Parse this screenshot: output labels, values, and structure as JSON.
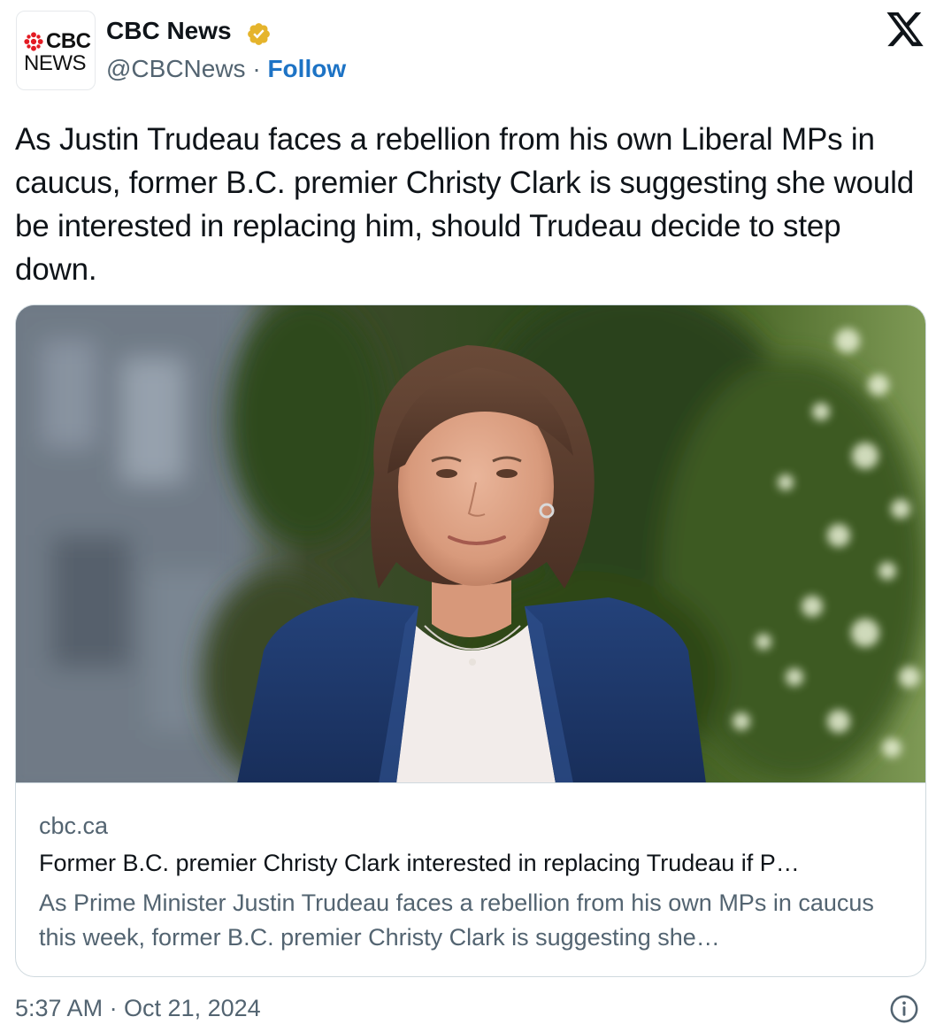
{
  "author": {
    "avatar_line1": "CBC",
    "avatar_line2": "NEWS",
    "name": "CBC News",
    "verified_icon": "verified-badge-icon",
    "verified_color": "#e5b42c",
    "handle": "@CBCNews",
    "separator": " · ",
    "follow_label": "Follow",
    "follow_color": "#1d73c5"
  },
  "platform": {
    "logo_icon": "x-logo-icon"
  },
  "tweet": {
    "text": "As Justin Trudeau faces a rebellion from his own Liberal MPs in caucus, former B.C. premier Christy Clark is suggesting she would be interested in replacing him, should Trudeau decide to step down."
  },
  "card": {
    "image_icon": "article-photo",
    "domain": "cbc.ca",
    "title": "Former B.C. premier Christy Clark interested in replacing Trudeau if P…",
    "description": "As Prime Minister Justin Trudeau faces a rebellion from his own MPs in caucus this week, former B.C. premier Christy Clark is suggesting she…"
  },
  "footer": {
    "timestamp": "5:37 AM · Oct 21, 2024",
    "info_icon": "info-icon"
  },
  "colors": {
    "text_primary": "#0f1419",
    "text_secondary": "#536471",
    "border": "#cfd9de",
    "cbc_red": "#e31b23"
  }
}
